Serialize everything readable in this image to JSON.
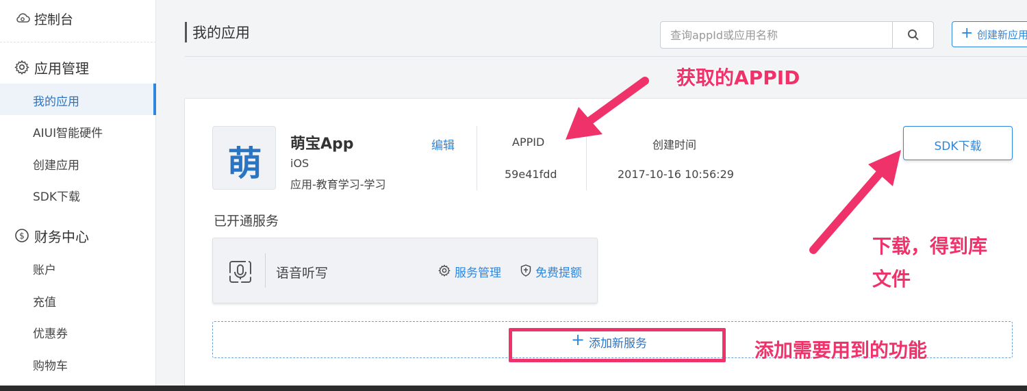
{
  "sidebar": {
    "console_label": "控制台",
    "groups": [
      {
        "label": "应用管理",
        "icon": "gear-icon",
        "items": [
          {
            "label": "我的应用",
            "active": true
          },
          {
            "label": "AIUI智能硬件"
          },
          {
            "label": "创建应用"
          },
          {
            "label": "SDK下载"
          }
        ]
      },
      {
        "label": "财务中心",
        "icon": "dollar-circle-icon",
        "items": [
          {
            "label": "账户"
          },
          {
            "label": "充值"
          },
          {
            "label": "优惠券"
          },
          {
            "label": "购物车"
          }
        ]
      }
    ]
  },
  "header": {
    "title": "我的应用",
    "search_placeholder": "查询appId或应用名称",
    "create_label": "创建新应用"
  },
  "app": {
    "icon_char": "萌",
    "name": "萌宝App",
    "platform": "iOS",
    "category": "应用-教育学习-学习",
    "edit_label": "编辑",
    "appid_label": "APPID",
    "appid_value": "59e41fdd",
    "created_label": "创建时间",
    "created_value": "2017-10-16 10:56:29",
    "sdk_download_label": "SDK下载"
  },
  "services": {
    "heading": "已开通服务",
    "items": [
      {
        "name": "语音听写",
        "manage_label": "服务管理",
        "free_label": "免费提额"
      }
    ],
    "add_label": "添加新服务"
  },
  "annotations": {
    "appid_note": "获取的APPID",
    "download_note_line1": "下载，得到库",
    "download_note_line2": "文件",
    "add_note": "添加需要用到的功能",
    "color": "#f0326a"
  },
  "colors": {
    "accent": "#2e86de",
    "annotation": "#f0326a"
  }
}
